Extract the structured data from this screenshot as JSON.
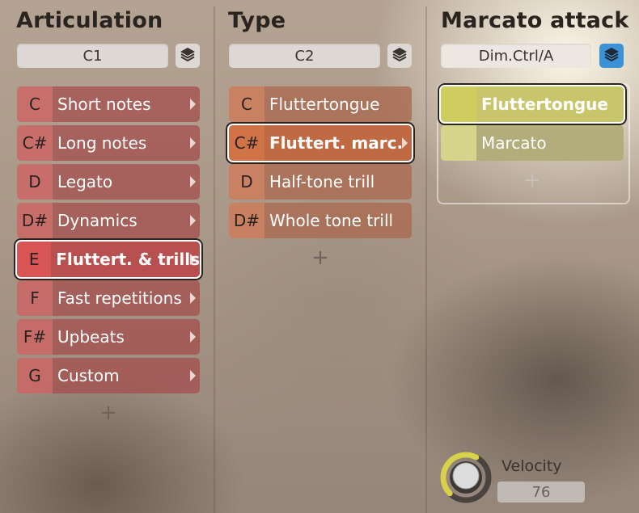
{
  "columns": [
    {
      "title": "Articulation",
      "selector": "C1",
      "items": [
        {
          "key": "C",
          "label": "Short notes"
        },
        {
          "key": "C#",
          "label": "Long notes"
        },
        {
          "key": "D",
          "label": "Legato"
        },
        {
          "key": "D#",
          "label": "Dynamics"
        },
        {
          "key": "E",
          "label": "Fluttert. & trills"
        },
        {
          "key": "F",
          "label": "Fast repetitions"
        },
        {
          "key": "F#",
          "label": "Upbeats"
        },
        {
          "key": "G",
          "label": "Custom"
        }
      ],
      "add_label": "+"
    },
    {
      "title": "Type",
      "selector": "C2",
      "items": [
        {
          "key": "C",
          "label": "Fluttertongue"
        },
        {
          "key": "C#",
          "label": "Fluttert. marc."
        },
        {
          "key": "D",
          "label": "Half-tone trill"
        },
        {
          "key": "D#",
          "label": "Whole tone trill"
        }
      ],
      "add_label": "+"
    },
    {
      "title": "Marcato attack",
      "selector": "Dim.Ctrl/A",
      "items": [
        {
          "key": "",
          "label": "Fluttertongue"
        },
        {
          "key": "",
          "label": "Marcato"
        }
      ],
      "add_label": "+"
    }
  ],
  "velocity": {
    "label": "Velocity",
    "value": "76",
    "level": 0.6
  },
  "icons": {
    "layer": "layers-icon",
    "knob": "velocity-knob"
  },
  "colors": {
    "articulation": "#a54b4b",
    "type": "#aa6950",
    "marcato": "#c9c56a",
    "layer_active": "#3a93d6",
    "knob_ring": "#d8d24a"
  }
}
